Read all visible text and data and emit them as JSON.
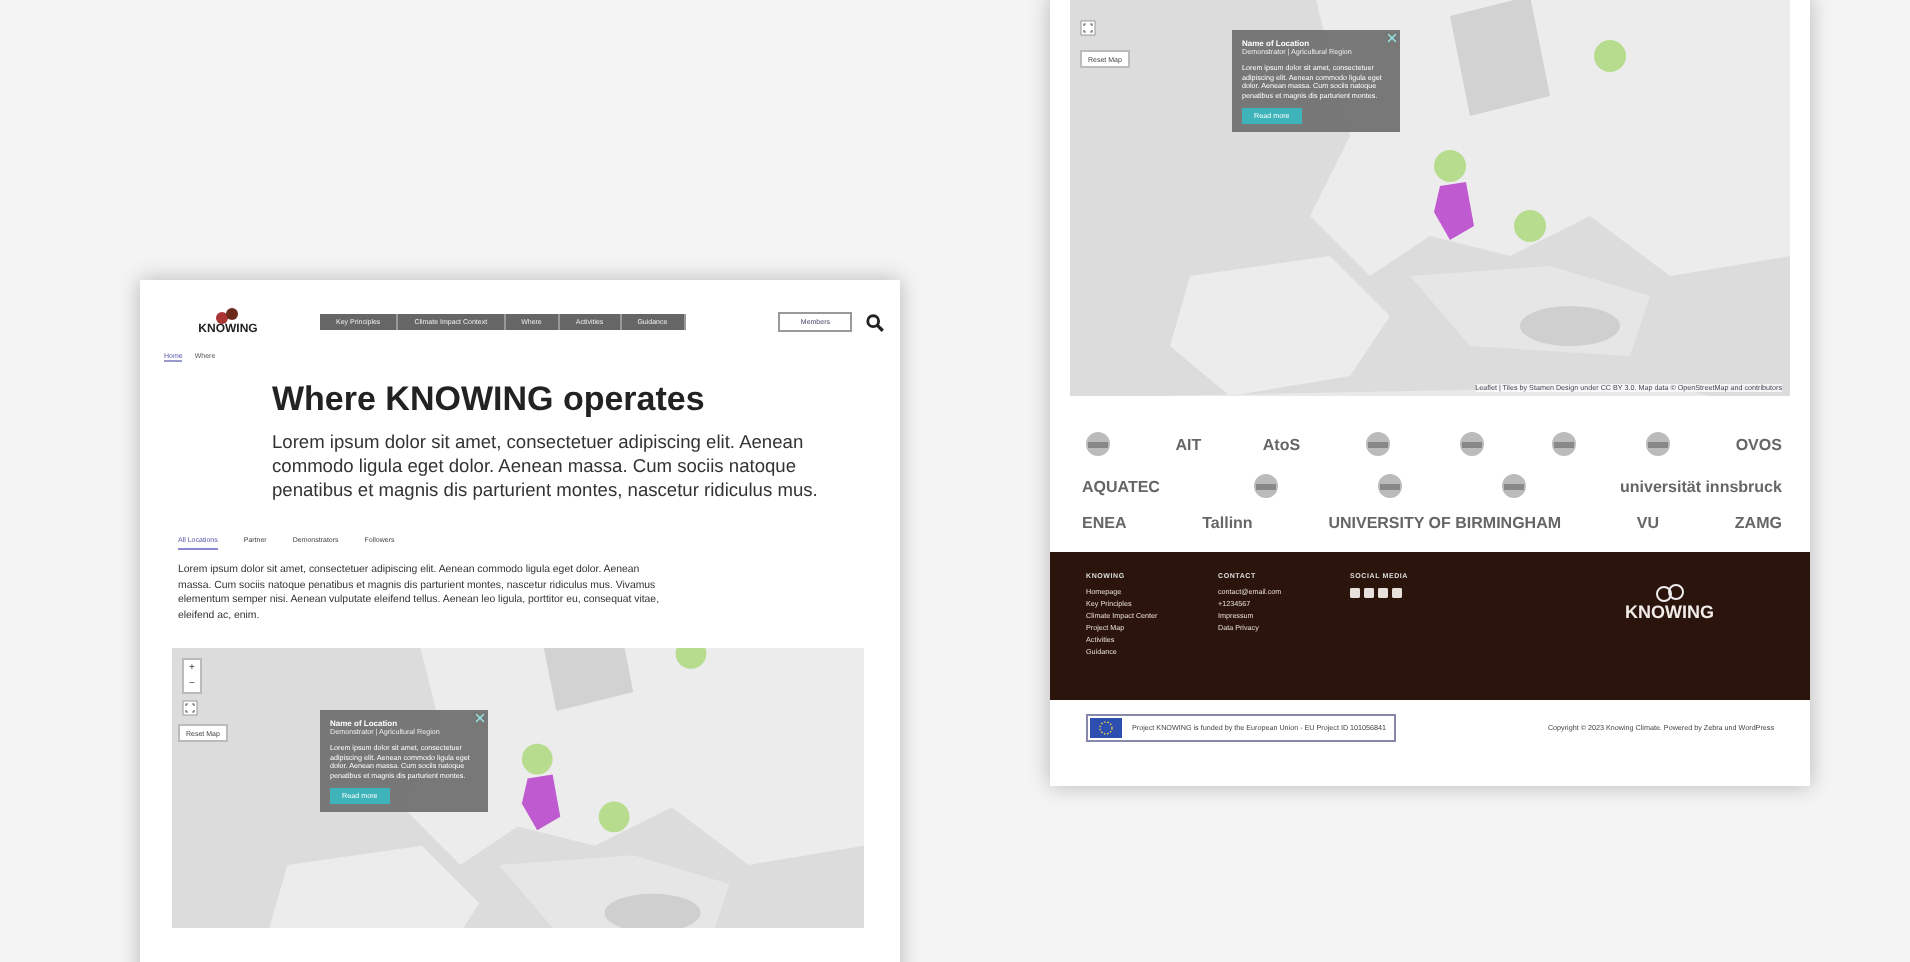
{
  "left_page": {
    "header": {
      "logo": "KNOWING",
      "nav": [
        "Key Principles",
        "Climate Impact Context",
        "Where",
        "Activities",
        "Guidance"
      ],
      "members_button": "Members"
    },
    "breadcrumb": [
      {
        "label": "Home",
        "selected": true
      },
      {
        "label": "Where",
        "selected": false
      }
    ],
    "title": "Where KNOWING operates",
    "intro": "Lorem ipsum dolor sit amet, consectetuer adipiscing elit. Aenean commodo ligula eget dolor. Aenean massa. Cum sociis natoque penatibus et magnis dis parturient montes, nascetur ridiculus mus.",
    "tabs": [
      {
        "label": "All Locations",
        "selected": true
      },
      {
        "label": "Partner",
        "selected": false
      },
      {
        "label": "Demonstrators",
        "selected": false
      },
      {
        "label": "Followers",
        "selected": false
      }
    ],
    "body": "Lorem ipsum dolor sit amet, consectetuer adipiscing elit. Aenean commodo ligula eget dolor. Aenean massa. Cum sociis natoque penatibus et magnis dis parturient montes, nascetur ridiculus mus. Vivamus elementum semper nisi. Aenean vulputate eleifend tellus. Aenean leo ligula, porttitor eu, consequat vitae, eleifend ac, enim.",
    "map": {
      "zoom": [
        "+",
        "−"
      ],
      "reset": "Reset Map",
      "popup": {
        "title": "Name of Location",
        "subtitle": "Demonstrator | Agricultural Region",
        "text": "Lorem ipsum dolor sit amet, consectetuer adipiscing elit. Aenean commodo ligula eget dolor. Aenean massa. Cum sociis natoque penatibus et magnis dis parturient montes.",
        "button": "Read more"
      }
    }
  },
  "right_page": {
    "map": {
      "reset": "Reset Map",
      "popup": {
        "title": "Name of Location",
        "subtitle": "Demonstrator | Agricultural Region",
        "text": "Lorem ipsum dolor sit amet, consectetuer adipiscing elit. Aenean commodo ligula eget dolor. Aenean massa. Cum sociis natoque penatibus et magnis dis parturient montes.",
        "button": "Read more"
      },
      "attribution": "Leaflet | Tiles by Stamen Design under CC BY 3.0. Map data © OpenStreetMap and contributors"
    },
    "partner_rows": [
      [
        {
          "kind": "mark"
        },
        {
          "kind": "text",
          "text": "AIT"
        },
        {
          "kind": "text",
          "text": "AtoS"
        },
        {
          "kind": "mark"
        },
        {
          "kind": "mark"
        },
        {
          "kind": "mark"
        },
        {
          "kind": "mark"
        },
        {
          "kind": "text",
          "text": "OVOS"
        }
      ],
      [
        {
          "kind": "text",
          "text": "AQUATEC"
        },
        {
          "kind": "mark"
        },
        {
          "kind": "mark"
        },
        {
          "kind": "mark"
        },
        {
          "kind": "text",
          "text": "universität innsbruck"
        }
      ],
      [
        {
          "kind": "text",
          "text": "ENEA"
        },
        {
          "kind": "text",
          "text": "Tallinn"
        },
        {
          "kind": "text",
          "text": "UNIVERSITY OF BIRMINGHAM"
        },
        {
          "kind": "text",
          "text": "VU"
        },
        {
          "kind": "text",
          "text": "ZAMG"
        }
      ]
    ],
    "footer": {
      "columns": [
        {
          "heading": "KNOWING",
          "links": [
            "Homepage",
            "Key Principles",
            "Climate Impact Center",
            "Project Map",
            "Activities",
            "Guidance"
          ]
        },
        {
          "heading": "CONTACT",
          "links": [
            "contact@email.com",
            "+1234567",
            "Impressum",
            "Data Privacy"
          ]
        },
        {
          "heading": "SOCIAL MEDIA"
        }
      ],
      "logo": "KNOWING"
    },
    "funding": "Project KNOWING is funded by the European Union - EU Project ID 101056841",
    "copyright": "Copyright © 2023 Knowing Climate. Powered by Zebra und WordPress"
  }
}
